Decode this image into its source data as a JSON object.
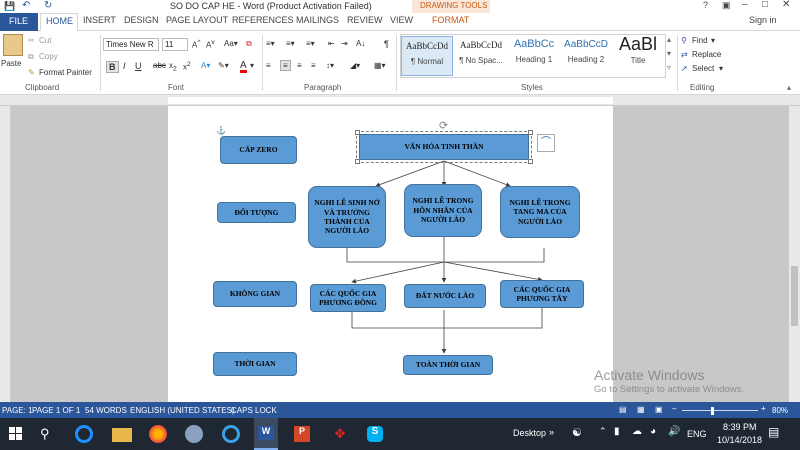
{
  "window": {
    "title": "SO DO CAP HE - Word (Product Activation Failed)",
    "contextual_group": "DRAWING TOOLS",
    "sign_in": "Sign in",
    "help": "?"
  },
  "tabs": [
    "FILE",
    "HOME",
    "INSERT",
    "DESIGN",
    "PAGE LAYOUT",
    "REFERENCES",
    "MAILINGS",
    "REVIEW",
    "VIEW",
    "FORMAT"
  ],
  "ribbon": {
    "clipboard": {
      "paste": "Paste",
      "cut": "Cut",
      "copy": "Copy",
      "format_painter": "Format Painter",
      "label": "Clipboard"
    },
    "font": {
      "name": "Times New R",
      "size": "11",
      "label": "Font"
    },
    "paragraph": {
      "label": "Paragraph"
    },
    "styles": {
      "items": [
        {
          "preview": "AaBbCcDd",
          "name": "¶ Normal"
        },
        {
          "preview": "AaBbCcDd",
          "name": "¶ No Spac..."
        },
        {
          "preview": "AaBbCc",
          "name": "Heading 1"
        },
        {
          "preview": "AaBbCcD",
          "name": "Heading 2"
        },
        {
          "preview": "AaBl",
          "name": "Title"
        }
      ],
      "label": "Styles"
    },
    "editing": {
      "find": "Find",
      "replace": "Replace",
      "select": "Select",
      "label": "Editing"
    }
  },
  "diagram": {
    "left": [
      "CẤP ZERO",
      "ĐỐI TƯỢNG",
      "KHÔNG GIAN",
      "THỜI GIAN"
    ],
    "top": "VĂN HÓA TINH THẦN",
    "row2": [
      "NGHI LỄ SINH NỞ VÀ TRƯỞNG THÀNH CỦA NGƯỜI LÀO",
      "NGHI LỄ TRONG HÔN NHÂN CỦA NGƯỜI LÀO",
      "NGHI LỄ TRONG TANG MA CỦA NGƯỜI LÀO"
    ],
    "row3": [
      "CÁC QUỐC GIA PHƯƠNG ĐÔNG",
      "ĐẤT NƯỚC LÀO",
      "CÁC QUỐC GIA PHƯƠNG TÂY"
    ],
    "row4": "TOÀN THỜI GIAN"
  },
  "status": {
    "page": "PAGE: 1",
    "pageof": "PAGE 1 OF 1",
    "words": "54 WORDS",
    "lang": "ENGLISH (UNITED STATES)",
    "caps": "CAPS LOCK",
    "zoom": "80%"
  },
  "watermark": {
    "line1": "Activate Windows",
    "line2": "Go to Settings to activate Windows."
  },
  "taskbar": {
    "desktop": "Desktop",
    "lang": "ENG",
    "time": "8:39 PM",
    "date": "10/14/2018"
  },
  "colors": {
    "accent": "#2b579a",
    "shape_fill": "#5b9bd5",
    "contextual": "#c55a11"
  }
}
